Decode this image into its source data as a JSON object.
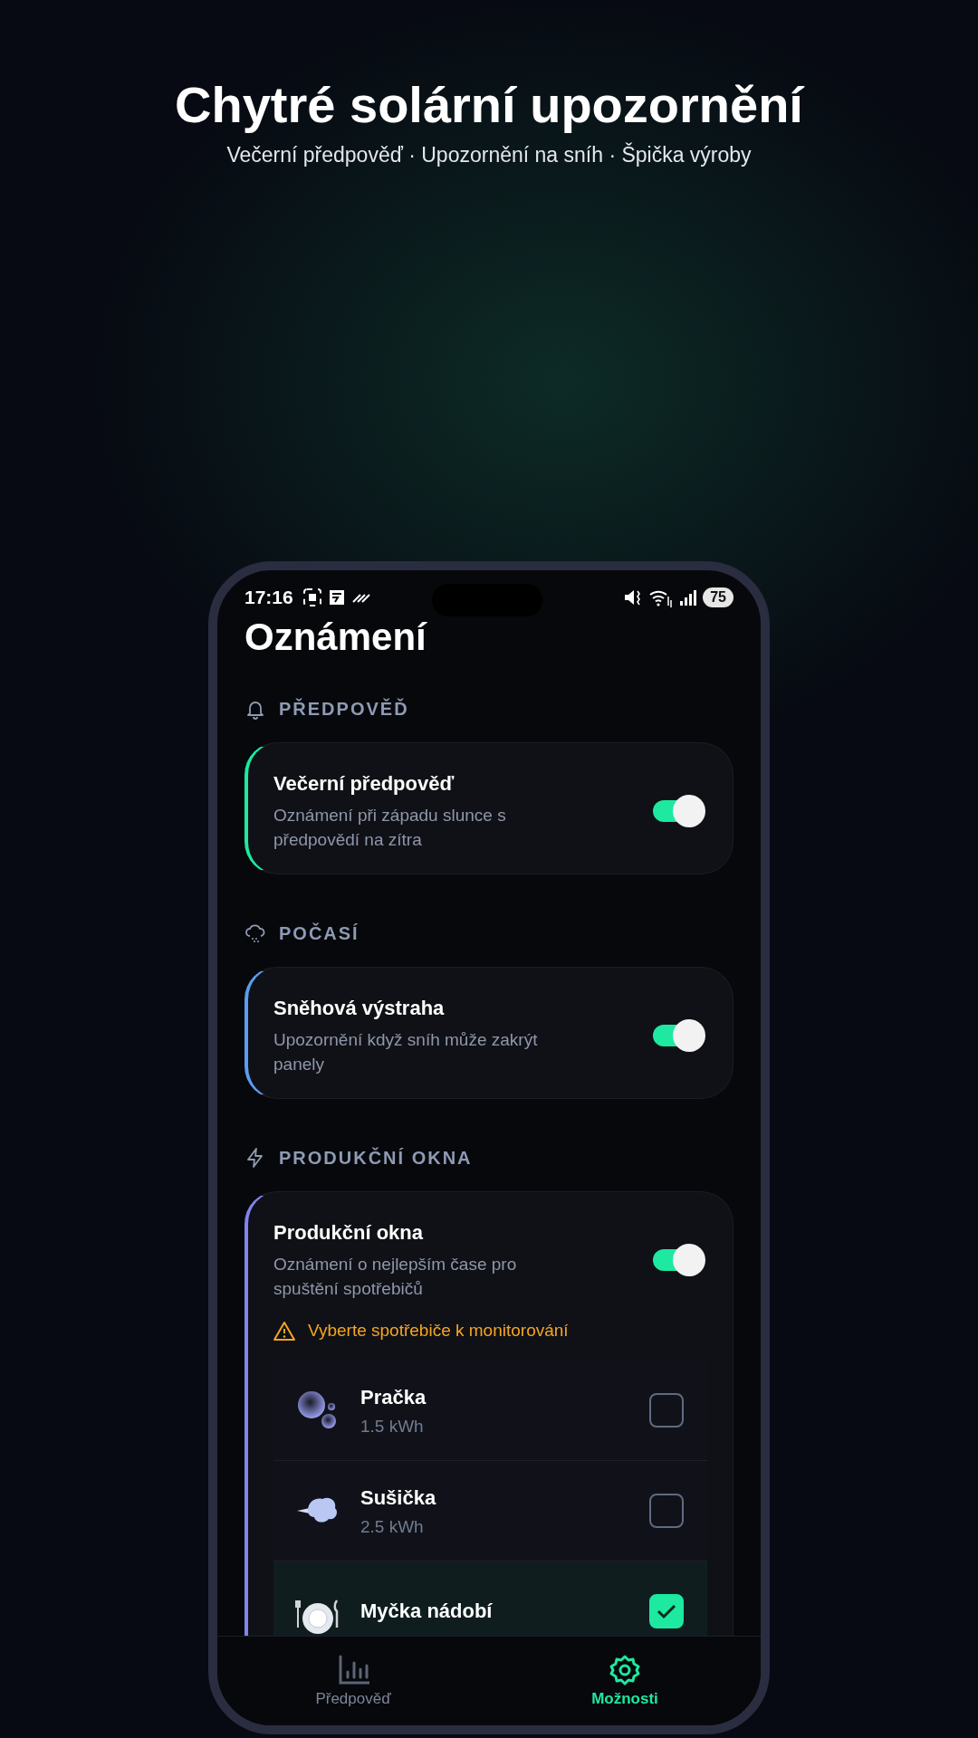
{
  "header": {
    "title": "Chytré solární upozornění",
    "subtitle": "Večerní předpověď · Upozornění na sníh · Špička výroby"
  },
  "status_bar": {
    "time": "17:16",
    "battery": "75"
  },
  "screen_title": "Oznámení",
  "sections": [
    {
      "label": "PŘEDPOVĚĎ",
      "cards": [
        {
          "title": "Večerní předpověď",
          "description": "Oznámení při západu slunce s předpovědí na zítra",
          "on": true,
          "color": "#1de9a0"
        }
      ]
    },
    {
      "label": "POČASÍ",
      "cards": [
        {
          "title": "Sněhová výstraha",
          "description": "Upozornění když sníh může zakrýt panely",
          "on": true,
          "color": "#5b9cf0"
        }
      ]
    },
    {
      "label": "PRODUKČNÍ OKNA",
      "cards": [
        {
          "title": "Produkční okna",
          "description": "Oznámení o nejlepším čase pro spuštění spotřebičů",
          "on": true,
          "color": "#8183f0",
          "warning": "Vyberte spotřebiče k monitorování",
          "appliances": [
            {
              "name": "Pračka",
              "energy": "1.5 kWh",
              "checked": false
            },
            {
              "name": "Sušička",
              "energy": "2.5 kWh",
              "checked": false
            },
            {
              "name": "Myčka nádobí",
              "checked": true
            }
          ]
        }
      ]
    }
  ],
  "nav": [
    {
      "label": "Předpověď",
      "selected": false
    },
    {
      "label": "Možnosti",
      "selected": true
    }
  ]
}
